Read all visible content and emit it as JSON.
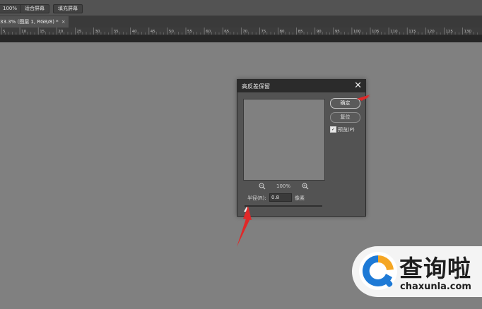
{
  "options_bar": {
    "zoom_button": "100%",
    "fit_screen_button": "适合屏幕",
    "fill_screen_button": "填充屏幕"
  },
  "document_tab": {
    "title": "33.3% (图层 1, RGB/8) *",
    "close": "×"
  },
  "ruler": {
    "labels": [
      "5",
      "10",
      "15",
      "20",
      "25",
      "30",
      "35",
      "40",
      "45",
      "50",
      "55",
      "60",
      "65",
      "70",
      "75",
      "80",
      "85",
      "90",
      "95",
      "100",
      "105",
      "110",
      "115",
      "120",
      "125",
      "130"
    ]
  },
  "dialog": {
    "title": "高反差保留",
    "close": "✕",
    "ok_button": "确定",
    "reset_button": "复位",
    "preview_checkbox": {
      "label": "预览(P)",
      "checked": true
    },
    "zoom": {
      "out_icon": "zoom-out-icon",
      "value": "100%",
      "in_icon": "zoom-in-icon"
    },
    "radius": {
      "label": "半径(R):",
      "value": "0.8",
      "unit": "像素"
    },
    "slider_fraction": 0.0
  },
  "watermark": {
    "brand": "查询啦",
    "url": "chaxunla.com"
  },
  "colors": {
    "canvas": "#808080",
    "panel": "#535353",
    "title_bar": "#2b2b2b",
    "annotation_arrow": "#e02828",
    "logo_blue": "#1e7ad6",
    "logo_orange": "#f5a623"
  }
}
